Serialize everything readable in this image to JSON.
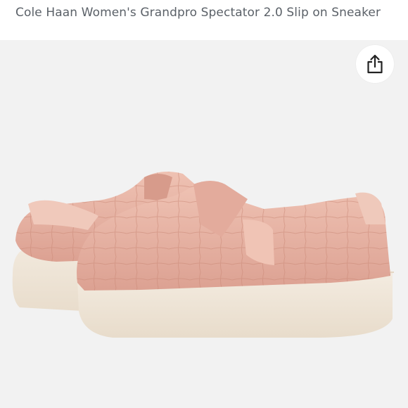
{
  "product": {
    "title": "Cole Haan Women's Grandpro Spectator 2.0 Slip on Sneaker"
  },
  "icons": {
    "share": "share-icon"
  },
  "colors": {
    "title_text": "#5b6168",
    "image_background": "#f2f2f2",
    "shoe_upper": "#e8b3a3",
    "shoe_sole": "#f1e8dc"
  }
}
